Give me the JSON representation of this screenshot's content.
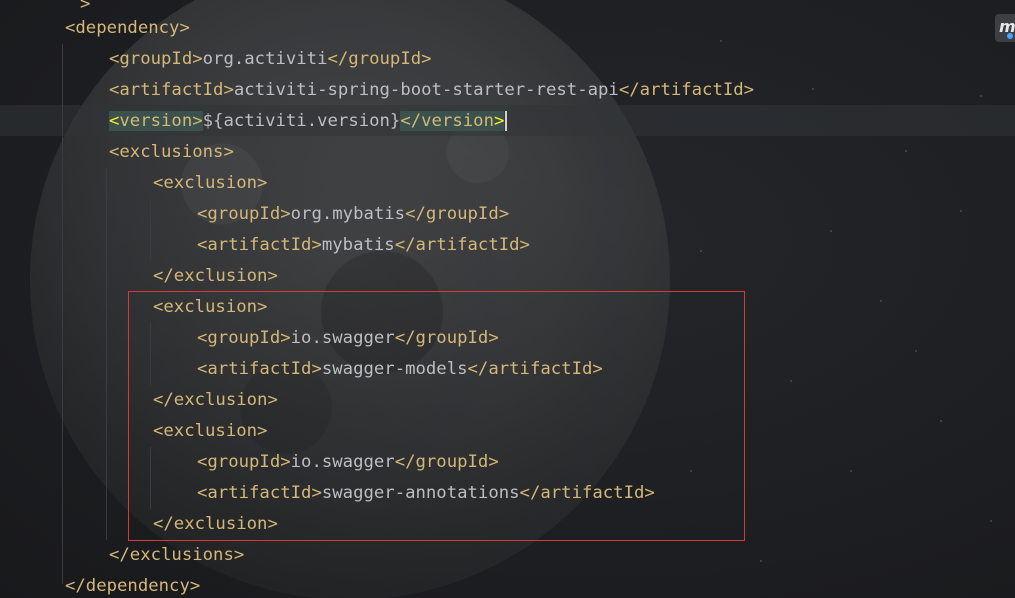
{
  "editor": {
    "badge_icon": "maven-icon",
    "badge_letter": "m",
    "top_fragment": ">",
    "lines": [
      {
        "indent": 0,
        "parts": [
          {
            "k": "tag",
            "t": "<dependency>"
          }
        ]
      },
      {
        "indent": 1,
        "parts": [
          {
            "k": "tag",
            "t": "<groupId>"
          },
          {
            "k": "txt",
            "t": "org.activiti"
          },
          {
            "k": "tag",
            "t": "</groupId>"
          }
        ]
      },
      {
        "indent": 1,
        "parts": [
          {
            "k": "tag",
            "t": "<artifactId>"
          },
          {
            "k": "txt",
            "t": "activiti-spring-boot-starter-rest-api"
          },
          {
            "k": "tag",
            "t": "</artifactId>"
          }
        ]
      },
      {
        "indent": 1,
        "parts": [
          {
            "k": "tagopen",
            "t": "<"
          },
          {
            "k": "tagname",
            "t": "version"
          },
          {
            "k": "tagclose",
            "t": ">"
          },
          {
            "k": "txt",
            "t": "${activiti.version}"
          },
          {
            "k": "tagopen2",
            "t": "</version"
          },
          {
            "k": "tagclose2",
            "t": ">"
          }
        ],
        "current": true
      },
      {
        "indent": 1,
        "parts": [
          {
            "k": "tag",
            "t": "<exclusions>"
          }
        ]
      },
      {
        "indent": 2,
        "parts": [
          {
            "k": "tag",
            "t": "<exclusion>"
          }
        ]
      },
      {
        "indent": 3,
        "parts": [
          {
            "k": "tag",
            "t": "<groupId>"
          },
          {
            "k": "txt",
            "t": "org.mybatis"
          },
          {
            "k": "tag",
            "t": "</groupId>"
          }
        ]
      },
      {
        "indent": 3,
        "parts": [
          {
            "k": "tag",
            "t": "<artifactId>"
          },
          {
            "k": "txt",
            "t": "mybatis"
          },
          {
            "k": "tag",
            "t": "</artifactId>"
          }
        ]
      },
      {
        "indent": 2,
        "parts": [
          {
            "k": "tag",
            "t": "</exclusion>"
          }
        ]
      },
      {
        "indent": 2,
        "parts": [
          {
            "k": "tag",
            "t": "<exclusion>"
          }
        ]
      },
      {
        "indent": 3,
        "parts": [
          {
            "k": "tag",
            "t": "<groupId>"
          },
          {
            "k": "txt",
            "t": "io.swagger"
          },
          {
            "k": "tag",
            "t": "</groupId>"
          }
        ]
      },
      {
        "indent": 3,
        "parts": [
          {
            "k": "tag",
            "t": "<artifactId>"
          },
          {
            "k": "txt",
            "t": "swagger-models"
          },
          {
            "k": "tag",
            "t": "</artifactId>"
          }
        ]
      },
      {
        "indent": 2,
        "parts": [
          {
            "k": "tag",
            "t": "</exclusion>"
          }
        ]
      },
      {
        "indent": 2,
        "parts": [
          {
            "k": "tag",
            "t": "<exclusion>"
          }
        ]
      },
      {
        "indent": 3,
        "parts": [
          {
            "k": "tag",
            "t": "<groupId>"
          },
          {
            "k": "txt",
            "t": "io.swagger"
          },
          {
            "k": "tag",
            "t": "</groupId>"
          }
        ]
      },
      {
        "indent": 3,
        "parts": [
          {
            "k": "tag",
            "t": "<artifactId>"
          },
          {
            "k": "txt",
            "t": "swagger-annotations"
          },
          {
            "k": "tag",
            "t": "</artifactId>"
          }
        ]
      },
      {
        "indent": 2,
        "parts": [
          {
            "k": "tag",
            "t": "</exclusion>"
          }
        ]
      },
      {
        "indent": 1,
        "parts": [
          {
            "k": "tag",
            "t": "</exclusions>"
          }
        ]
      },
      {
        "indent": 0,
        "parts": [
          {
            "k": "tag",
            "t": "</dependency>"
          }
        ]
      }
    ]
  },
  "colors": {
    "tag": "#d5b778",
    "text": "#bcbec4",
    "highlight_bg": "#3b514d",
    "bracket_match": "#ffef28",
    "annotation_border": "#d33a3a"
  }
}
